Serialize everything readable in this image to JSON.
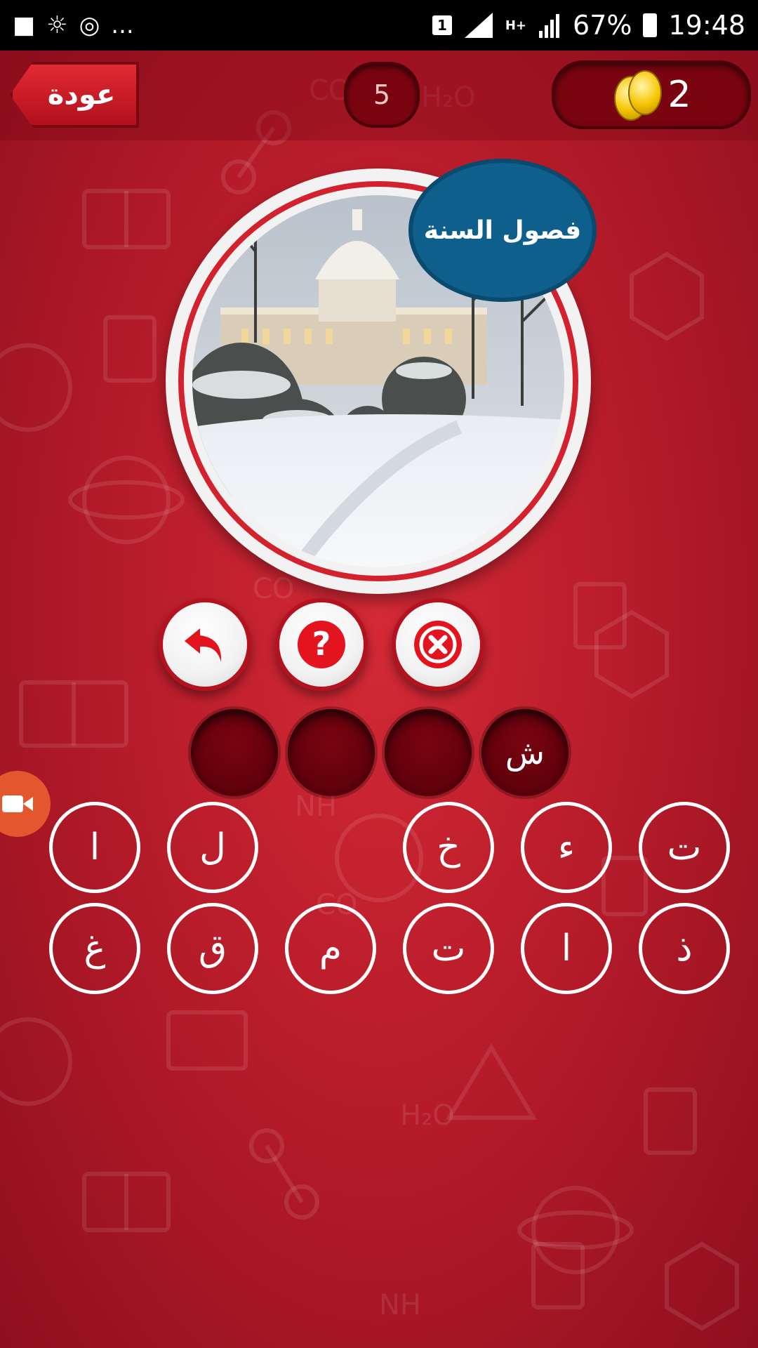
{
  "status_bar": {
    "sim_badge": "1",
    "network": "H+",
    "battery": "67%",
    "time": "19:48",
    "dots": "..."
  },
  "header": {
    "back_label": "عودة",
    "level": "5",
    "coins": "2"
  },
  "puzzle": {
    "category": "فصول السنة",
    "image_icon": "winter-capitol-photo"
  },
  "hints": [
    {
      "name": "undo",
      "icon": "undo-arrow-icon"
    },
    {
      "name": "help",
      "icon": "question-icon"
    },
    {
      "name": "remove",
      "icon": "close-x-icon"
    }
  ],
  "answer_slots": [
    "",
    "",
    "",
    "ش"
  ],
  "letters_row1": [
    "ا",
    "ل",
    "",
    "خ",
    "ء",
    "ت"
  ],
  "letters_row2": [
    "غ",
    "ق",
    "م",
    "ت",
    "ا",
    "ذ"
  ],
  "colors": {
    "background": "#b81c2a",
    "bubble": "#0e5f8c",
    "slot": "#6a0610",
    "accent": "#e4572e"
  }
}
